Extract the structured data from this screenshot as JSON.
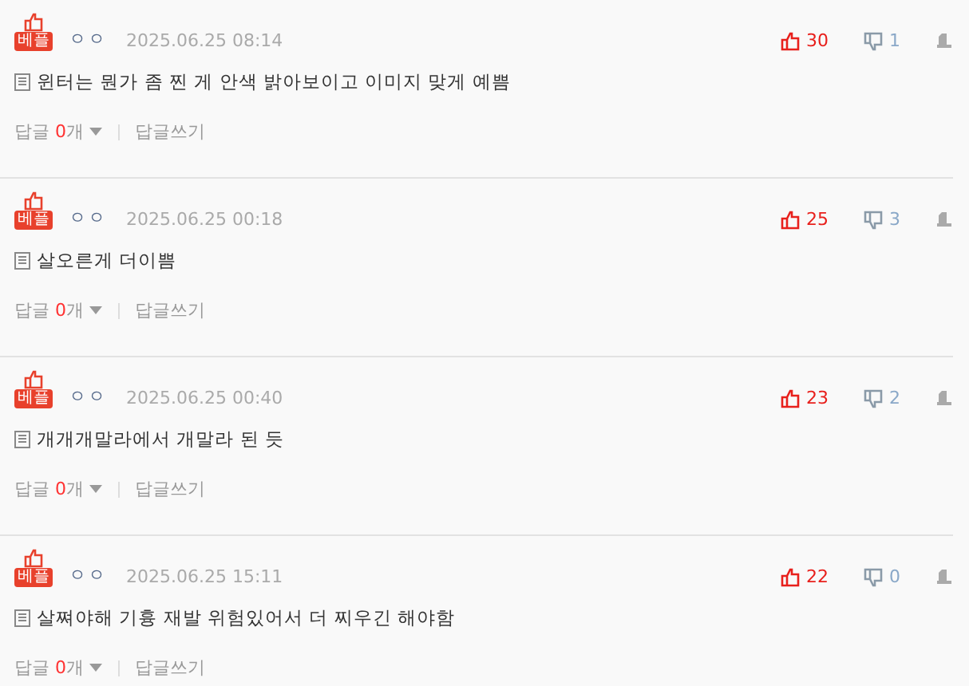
{
  "comments": [
    {
      "badge": "베플",
      "nickname": "ㅇㅇ",
      "date": "2025.06.25 08:14",
      "likes": "30",
      "dislikes": "1",
      "text": "윈터는 뭔가 좀 찐 게 안색 밝아보이고 이미지 맞게 예쁨",
      "reply_label": "답글",
      "reply_count": "0",
      "reply_unit": "개",
      "write_reply": "답글쓰기"
    },
    {
      "badge": "베플",
      "nickname": "ㅇㅇ",
      "date": "2025.06.25 00:18",
      "likes": "25",
      "dislikes": "3",
      "text": "살오른게 더이쁨",
      "reply_label": "답글",
      "reply_count": "0",
      "reply_unit": "개",
      "write_reply": "답글쓰기"
    },
    {
      "badge": "베플",
      "nickname": "ㅇㅇ",
      "date": "2025.06.25 00:40",
      "likes": "23",
      "dislikes": "2",
      "text": "개개개말라에서 개말라 된 듯",
      "reply_label": "답글",
      "reply_count": "0",
      "reply_unit": "개",
      "write_reply": "답글쓰기"
    },
    {
      "badge": "베플",
      "nickname": "ㅇㅇ",
      "date": "2025.06.25 15:11",
      "likes": "22",
      "dislikes": "0",
      "text": "살쪄야해 기흉 재발 위험있어서 더 찌우긴 해야함",
      "reply_label": "답글",
      "reply_count": "0",
      "reply_unit": "개",
      "write_reply": "답글쓰기"
    }
  ]
}
